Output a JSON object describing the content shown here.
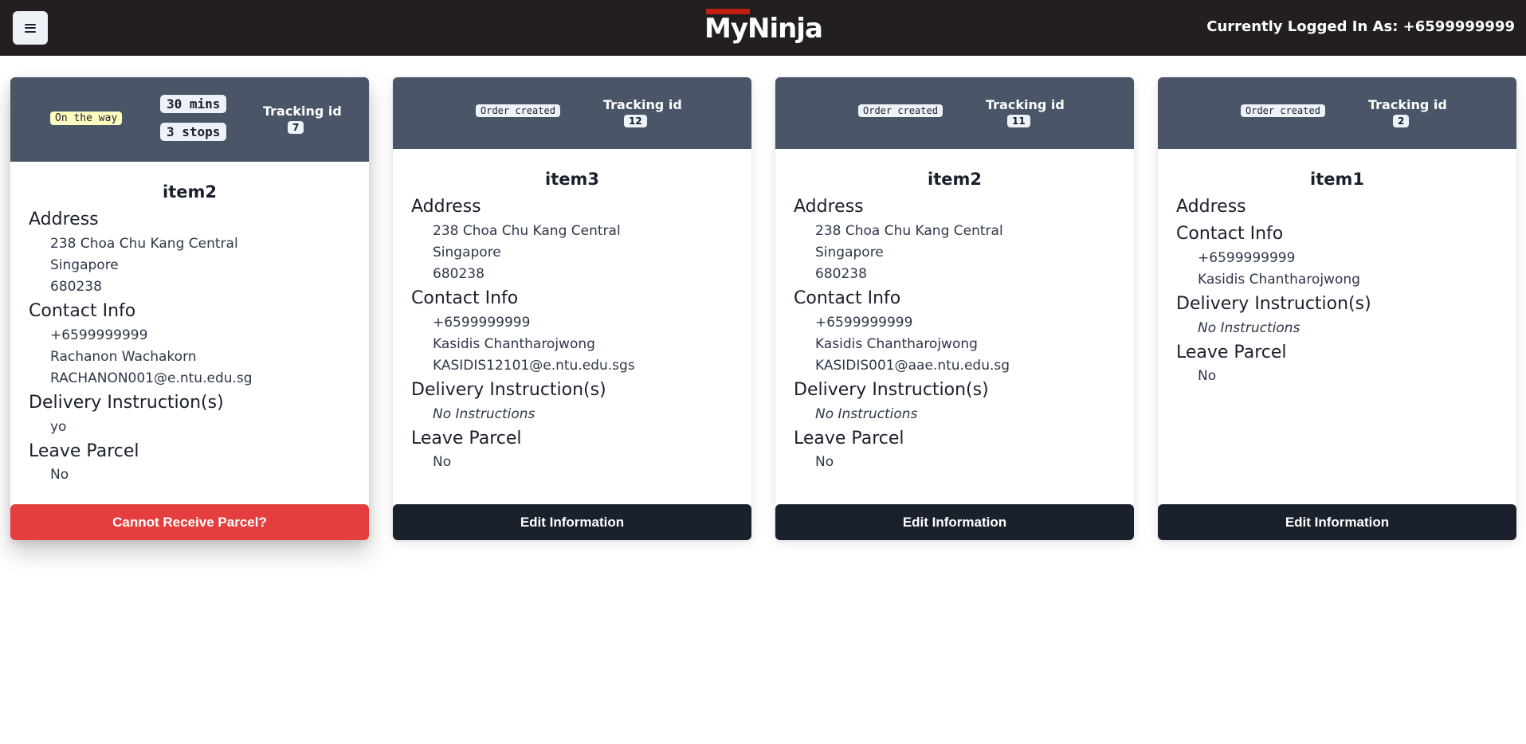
{
  "header": {
    "logo_text": "MyNinja",
    "logged_in_label": "Currently Logged In As: +6599999999"
  },
  "cards": [
    {
      "status": "On the way",
      "eta": "30 mins",
      "stops": "3 stops",
      "tracking_label": "Tracking id",
      "tracking_id": "7",
      "item_name": "item2",
      "address_heading": "Address",
      "address_lines": [
        "238 Choa Chu Kang Central",
        "Singapore",
        "680238"
      ],
      "contact_heading": "Contact Info",
      "contact_lines": [
        "+6599999999",
        "Rachanon Wachakorn",
        "RACHANON001@e.ntu.edu.sg"
      ],
      "instructions_heading": "Delivery Instruction(s)",
      "instructions": "yo",
      "leave_heading": "Leave Parcel",
      "leave_value": "No",
      "button_label": "Cannot Receive Parcel?"
    },
    {
      "status": "Order created",
      "tracking_label": "Tracking id",
      "tracking_id": "12",
      "item_name": "item3",
      "address_heading": "Address",
      "address_lines": [
        "238 Choa Chu Kang Central",
        "Singapore",
        "680238"
      ],
      "contact_heading": "Contact Info",
      "contact_lines": [
        "+6599999999",
        "Kasidis Chantharojwong",
        "KASIDIS12101@e.ntu.edu.sgs"
      ],
      "instructions_heading": "Delivery Instruction(s)",
      "instructions": "No Instructions",
      "leave_heading": "Leave Parcel",
      "leave_value": "No",
      "button_label": "Edit Information"
    },
    {
      "status": "Order created",
      "tracking_label": "Tracking id",
      "tracking_id": "11",
      "item_name": "item2",
      "address_heading": "Address",
      "address_lines": [
        "238 Choa Chu Kang Central",
        "Singapore",
        "680238"
      ],
      "contact_heading": "Contact Info",
      "contact_lines": [
        "+6599999999",
        "Kasidis Chantharojwong",
        "KASIDIS001@aae.ntu.edu.sg"
      ],
      "instructions_heading": "Delivery Instruction(s)",
      "instructions": "No Instructions",
      "leave_heading": "Leave Parcel",
      "leave_value": "No",
      "button_label": "Edit Information"
    },
    {
      "status": "Order created",
      "tracking_label": "Tracking id",
      "tracking_id": "2",
      "item_name": "item1",
      "address_heading": "Address",
      "contact_heading": "Contact Info",
      "contact_lines": [
        "+6599999999",
        "Kasidis Chantharojwong"
      ],
      "instructions_heading": "Delivery Instruction(s)",
      "instructions": "No Instructions",
      "leave_heading": "Leave Parcel",
      "leave_value": "No",
      "button_label": "Edit Information"
    }
  ]
}
